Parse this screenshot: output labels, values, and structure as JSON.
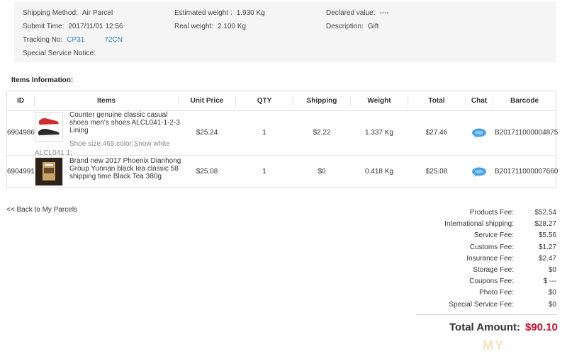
{
  "info": {
    "shipping_method_label": "Shipping Method:",
    "shipping_method_value": "Air Parcel",
    "estimated_weight_label": "Estimated weight :",
    "estimated_weight_value": "1.930 Kg",
    "declared_value_label": "Declared value:",
    "declared_value_value": "----",
    "submit_time_label": "Submit Time:",
    "submit_time_value": "2017/11/01 12:56",
    "real_weight_label": "Real weight:",
    "real_weight_value": "2.100 Kg",
    "description_label": "Description:",
    "description_value": "Gift",
    "tracking_label": "Tracking No:",
    "tracking_part1": "CP31",
    "tracking_part2": "72CN",
    "special_notice_label": "Special Service Notice:"
  },
  "items_title": "Items Information:",
  "table": {
    "headers": [
      "ID",
      "Items",
      "Unit Price",
      "QTY",
      "Shipping",
      "Weight",
      "Total",
      "Chat",
      "Barcode"
    ],
    "rows": [
      {
        "id": "6904986",
        "name": "Counter genuine classic casual shoes men's shoes ALCL041-1-2-3 Lining",
        "spec_line1": "Shoe size:465;color:Snow white",
        "spec_line2": "ALCL041 1;",
        "unit_price": "$25.24",
        "qty": "1",
        "shipping": "$2.22",
        "weight": "1.337 Kg",
        "total": "$27.46",
        "barcode": "B201711000004875"
      },
      {
        "id": "6904991",
        "name": "Brand new 2017 Phoenix Dianhong Group Yunnan black tea classic 58 shipping time Black Tea 380g",
        "unit_price": "$25.08",
        "qty": "1",
        "shipping": "$0",
        "weight": "0.418 Kg",
        "total": "$25.08",
        "barcode": "B201711000007660"
      }
    ]
  },
  "back_link": "<< Back to My Parcels",
  "fees": [
    {
      "label": "Products Fee:",
      "value": "$52.54"
    },
    {
      "label": "International shipping:",
      "value": "$28.27"
    },
    {
      "label": "Service Fee:",
      "value": "$5.56"
    },
    {
      "label": "Customs Fee:",
      "value": "$1.27"
    },
    {
      "label": "Insurance Fee:",
      "value": "$2.47"
    },
    {
      "label": "Storage Fee:",
      "value": "$0"
    },
    {
      "label": "Coupons Fee:",
      "value": "$ ---"
    },
    {
      "label": "Photo Fee:",
      "value": "$0"
    },
    {
      "label": "Special Service Fee:",
      "value": "$0"
    }
  ],
  "total_label": "Total Amount:",
  "total_value": "$90.10",
  "watermark": "MY",
  "colors": {
    "link": "#2a7fc9",
    "total": "#c8102e",
    "panel": "#f5f5f5"
  }
}
